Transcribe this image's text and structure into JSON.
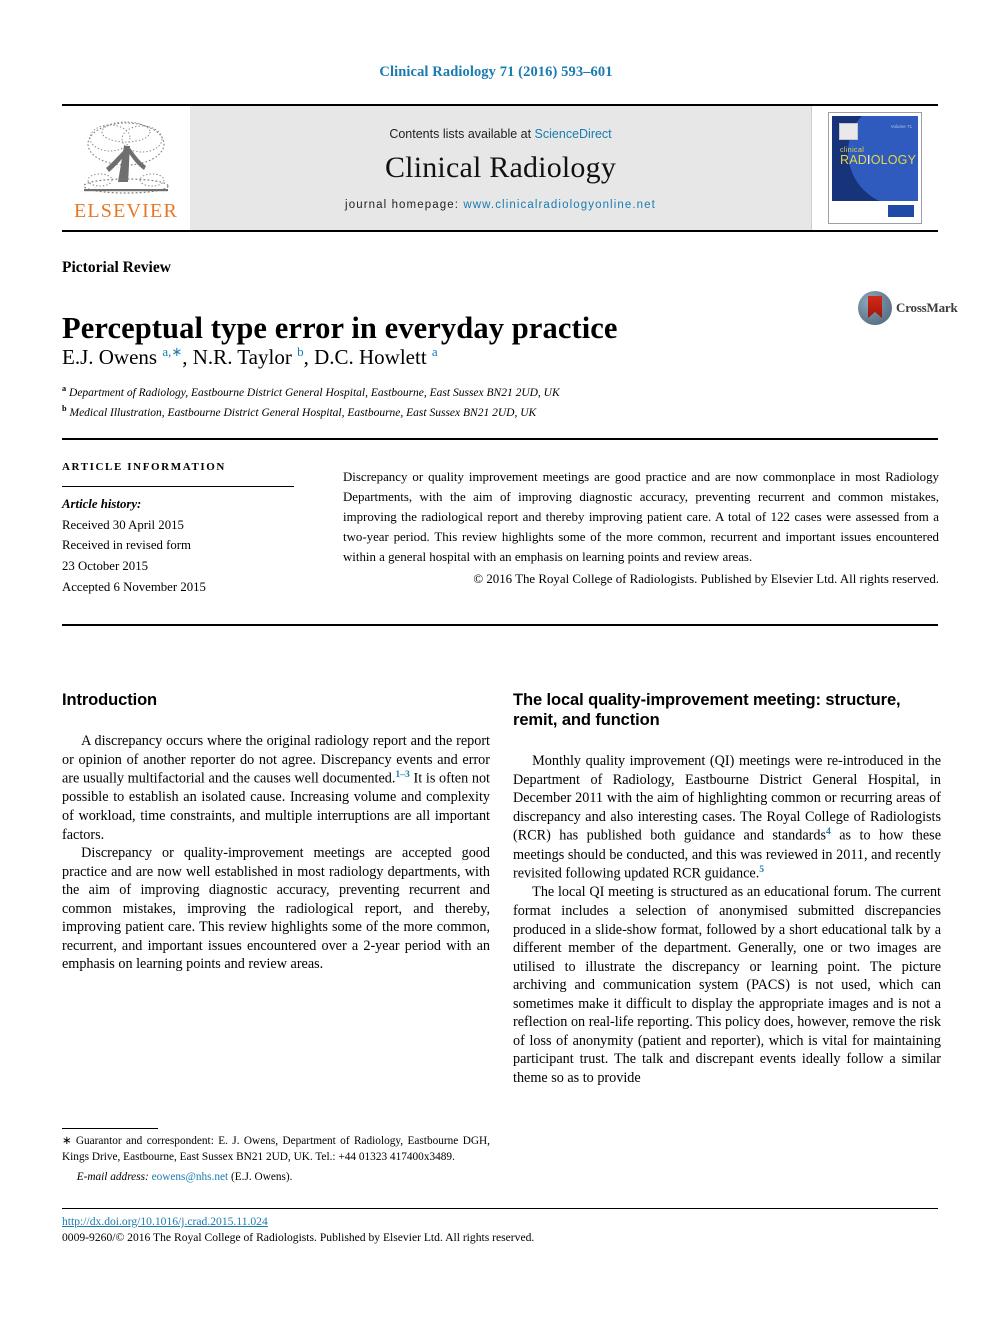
{
  "running_head": "Clinical Radiology 71 (2016) 593–601",
  "masthead": {
    "publisher_name": "ELSEVIER",
    "contents_prefix": "Contents lists available at ",
    "contents_link": "ScienceDirect",
    "journal_title": "Clinical Radiology",
    "homepage_prefix": "journal homepage: ",
    "homepage_url": "www.clinicalradiologyonline.net",
    "cover": {
      "line1": "clinical",
      "line2_a": "RAD",
      "line2_b": "I",
      "line2_c": "OLOGY",
      "corner_text": "Volume 71"
    }
  },
  "article": {
    "section_label": "Pictorial Review",
    "title": "Perceptual type error in everyday practice",
    "crossmark_label": "CrossMark",
    "authors_html": "E.J. Owens <sup>a,∗</sup>, N.R. Taylor <sup>b</sup>, D.C. Howlett <sup>a</sup>",
    "affiliation_a": "Department of Radiology, Eastbourne District General Hospital, Eastbourne, East Sussex BN21 2UD, UK",
    "affiliation_b": "Medical Illustration, Eastbourne District General Hospital, Eastbourne, East Sussex BN21 2UD, UK"
  },
  "article_info": {
    "heading": "ARTICLE INFORMATION",
    "history_label": "Article history:",
    "received": "Received 30 April 2015",
    "revised_label": "Received in revised form",
    "revised_date": "23 October 2015",
    "accepted": "Accepted 6 November 2015"
  },
  "abstract": {
    "text": "Discrepancy or quality improvement meetings are good practice and are now commonplace in most Radiology Departments, with the aim of improving diagnostic accuracy, preventing recurrent and common mistakes, improving the radiological report and thereby improving patient care. A total of 122 cases were assessed from a two-year period. This review highlights some of the more common, recurrent and important issues encountered within a general hospital with an emphasis on learning points and review areas.",
    "copyright": "© 2016 The Royal College of Radiologists. Published by Elsevier Ltd. All rights reserved."
  },
  "body": {
    "left": {
      "heading": "Introduction",
      "paragraph_1_html": "A discrepancy occurs where the original radiology report and the report or opinion of another reporter do not agree. Discrepancy events and error are usually multifactorial and the causes well documented.<sup>1–3</sup> It is often not possible to establish an isolated cause. Increasing volume and complexity of workload, time constraints, and multiple interruptions are all important factors.",
      "paragraph_2_html": "Discrepancy or quality-improvement meetings are accepted good practice and are now well established in most radiology departments, with the aim of improving diagnostic accuracy, preventing recurrent and common mistakes, improving the radiological report, and thereby, improving patient care. This review highlights some of the more common, recurrent, and important issues encountered over a 2-year period with an emphasis on learning points and review areas."
    },
    "right": {
      "heading": "The local quality-improvement meeting: structure, remit, and function",
      "paragraph_1_html": "Monthly quality improvement (QI) meetings were re-introduced in the Department of Radiology, Eastbourne District General Hospital, in December 2011 with the aim of highlighting common or recurring areas of discrepancy and also interesting cases. The Royal College of Radiologists (RCR) has published both guidance and standards<sup>4</sup> as to how these meetings should be conducted, and this was reviewed in 2011, and recently revisited following updated RCR guidance.<sup>5</sup>",
      "paragraph_2_html": "The local QI meeting is structured as an educational forum. The current format includes a selection of anonymised submitted discrepancies produced in a slide-show format, followed by a short educational talk by a different member of the department. Generally, one or two images are utilised to illustrate the discrepancy or learning point. The picture archiving and communication system (PACS) is not used, which can sometimes make it difficult to display the appropriate images and is not a reflection on real-life reporting. This policy does, however, remove the risk of loss of anonymity (patient and reporter), which is vital for maintaining participant trust. The talk and discrepant events ideally follow a similar theme so as to provide"
    }
  },
  "footnote": {
    "correspondence_html": "<span class=\"star\">∗</span> Guarantor and correspondent: E. J. Owens, Department of Radiology, Eastbourne DGH, Kings Drive, Eastbourne, East Sussex BN21 2UD, UK. Tel.: +44 01323 417400x3489.",
    "email_label": "E-mail address:",
    "email": "eowens@nhs.net",
    "email_suffix": "(E.J. Owens)."
  },
  "footer": {
    "doi": "http://dx.doi.org/10.1016/j.crad.2015.11.024",
    "issn_line": "0009-9260/© 2016 The Royal College of Radiologists. Published by Elsevier Ltd. All rights reserved."
  },
  "colors": {
    "link": "#1a7bb0",
    "elsevier_orange": "#E87722",
    "masthead_grey": "#e7e7e7",
    "cover_navy": "#17337a"
  }
}
